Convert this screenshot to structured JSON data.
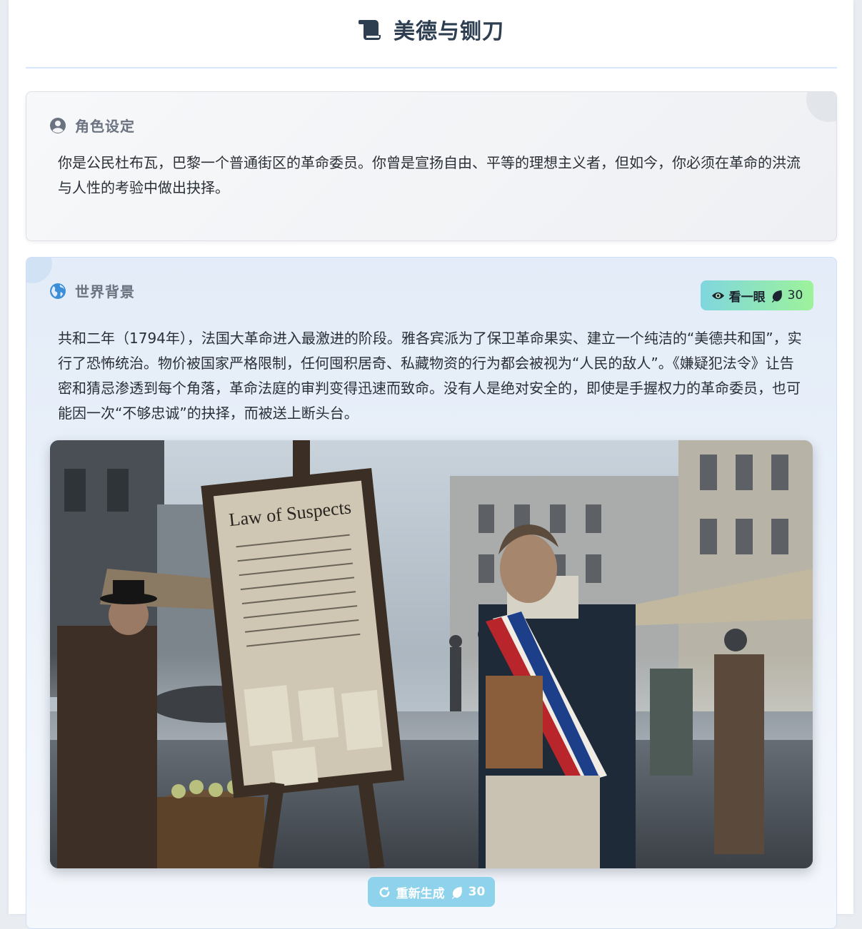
{
  "header": {
    "title": "美德与铡刀",
    "icon": "scroll-icon"
  },
  "role_card": {
    "heading": "角色设定",
    "icon": "user-circle-icon",
    "text": "你是公民杜布瓦，巴黎一个普通街区的革命委员。你曾是宣扬自由、平等的理想主义者，但如今，你必须在革命的洪流与人性的考验中做出抉择。"
  },
  "world_card": {
    "heading": "世界背景",
    "icon": "globe-icon",
    "text": "共和二年（1794年），法国大革命进入最激进的阶段。雅各宾派为了保卫革命果实、建立一个纯洁的“美德共和国”，实行了恐怖统治。物价被国家严格限制，任何囤积居奇、私藏物资的行为都会被视为“人民的敌人”。《嫌疑犯法令》让告密和猜忌渗透到每个角落，革命法庭的审判变得迅速而致命。没有人是绝对安全的，即使是手握权力的革命委员，也可能因一次“不够忠诚”的抉择，而被送上断头台。",
    "peek_button": {
      "label": "看一眼",
      "cost": "30",
      "icon": "eye-icon",
      "cost_icon": "leaf-icon"
    },
    "scene_image": {
      "notice_title": "Law of Suspects",
      "description_icon": "scene-image"
    },
    "regenerate_button": {
      "label": "重新生成",
      "cost": "30",
      "icon": "refresh-icon",
      "cost_icon": "leaf-icon"
    }
  },
  "colors": {
    "title": "#2c3e50",
    "peek_gradient_start": "#7fd6de",
    "peek_gradient_end": "#9df39a",
    "regen_bg": "#8ed2ec",
    "globe": "#3b8fd9"
  }
}
